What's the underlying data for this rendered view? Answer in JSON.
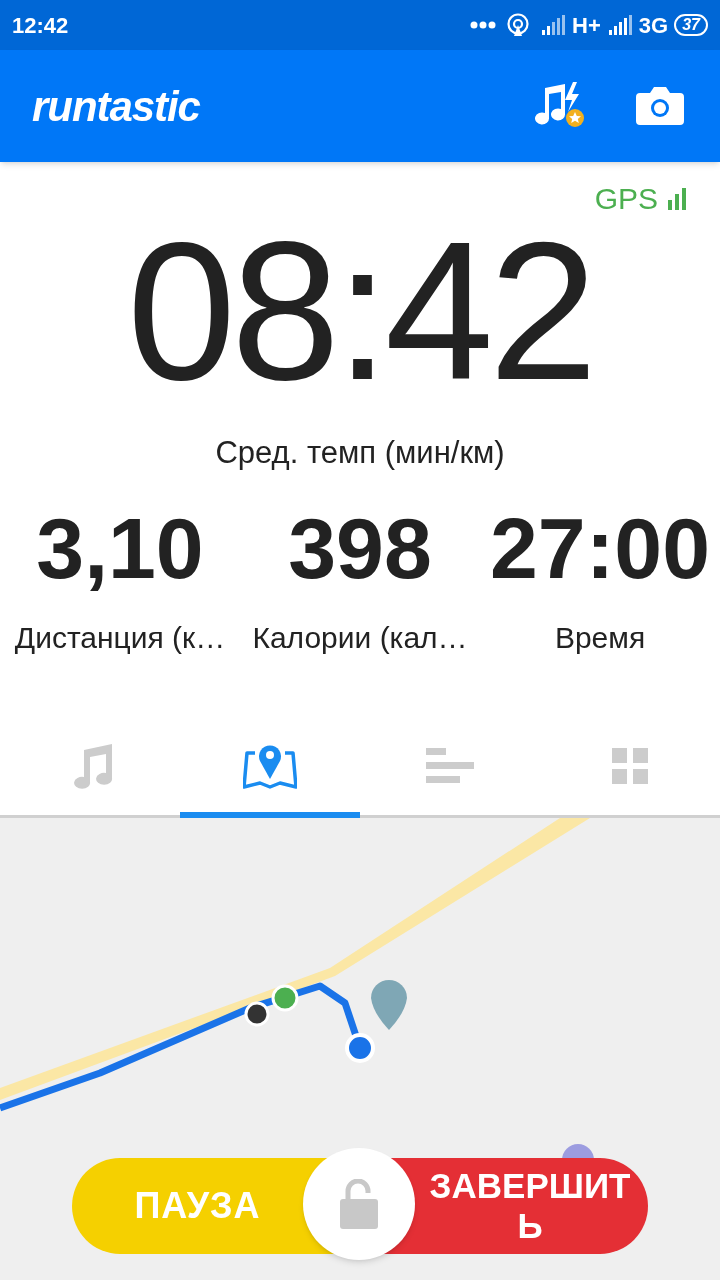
{
  "status_bar": {
    "time": "12:42",
    "network_1": "H+",
    "network_2": "3G",
    "battery": "37"
  },
  "app_bar": {
    "logo": "runtastic"
  },
  "gps": {
    "label": "GPS"
  },
  "main_metric": {
    "value": "08:42",
    "label": "Сред. темп (мин/км)"
  },
  "metrics": [
    {
      "value": "3,10",
      "label": "Дистанция (к…"
    },
    {
      "value": "398",
      "label": "Калории (кал…"
    },
    {
      "value": "27:00",
      "label": "Время"
    }
  ],
  "tabs": [
    {
      "kind": "music",
      "selected": false
    },
    {
      "kind": "map",
      "selected": true
    },
    {
      "kind": "stats",
      "selected": false
    },
    {
      "kind": "dashboard",
      "selected": false
    }
  ],
  "buttons": {
    "pause": "ПАУЗА",
    "finish": "ЗАВЕРШИТЬ"
  }
}
